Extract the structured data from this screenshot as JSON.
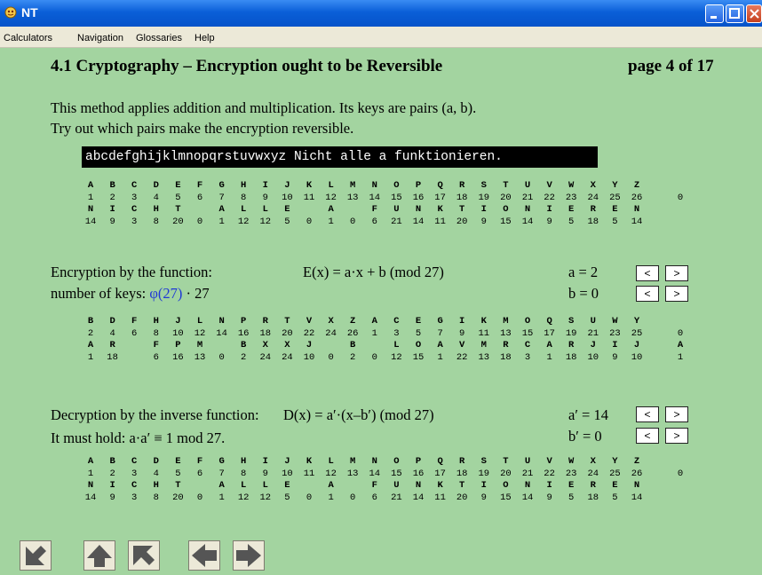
{
  "window": {
    "title": "NT"
  },
  "menu": [
    "Calculators",
    "Navigation",
    "Glossaries",
    "Help"
  ],
  "header": {
    "title": "4.1 Cryptography – Encryption ought to be Reversible",
    "page": "page 4 of 17"
  },
  "intro": {
    "line1": "This method applies addition and multiplication. Its keys are pairs (a, b).",
    "line2": "Try out which pairs make the encryption reversible."
  },
  "input": {
    "value": "abcdefghijklmnopqrstuvwxyz Nicht alle a funktionieren."
  },
  "table1": {
    "letters": [
      "A",
      "B",
      "C",
      "D",
      "E",
      "F",
      "G",
      "H",
      "I",
      "J",
      "K",
      "L",
      "M",
      "N",
      "O",
      "P",
      "Q",
      "R",
      "S",
      "T",
      "U",
      "V",
      "W",
      "X",
      "Y",
      "Z",
      ""
    ],
    "numbers": [
      "1",
      "2",
      "3",
      "4",
      "5",
      "6",
      "7",
      "8",
      "9",
      "10",
      "11",
      "12",
      "13",
      "14",
      "15",
      "16",
      "17",
      "18",
      "19",
      "20",
      "21",
      "22",
      "23",
      "24",
      "25",
      "26",
      "0"
    ],
    "letters2": [
      "N",
      "I",
      "C",
      "H",
      "T",
      "",
      "A",
      "L",
      "L",
      "E",
      "",
      "A",
      "",
      "F",
      "U",
      "N",
      "K",
      "T",
      "I",
      "O",
      "N",
      "I",
      "E",
      "R",
      "E",
      "N"
    ],
    "numbers2": [
      "14",
      "9",
      "3",
      "8",
      "20",
      "0",
      "1",
      "12",
      "12",
      "5",
      "0",
      "1",
      "0",
      "6",
      "21",
      "14",
      "11",
      "20",
      "9",
      "15",
      "14",
      "9",
      "5",
      "18",
      "5",
      "14"
    ]
  },
  "encryption": {
    "label": "Encryption by the function:",
    "formula": "E(x) = a·x + b (mod 27)",
    "keys_label": "number of keys:",
    "keys_phi": "φ(27)",
    "keys_rest": "· 27",
    "a_label": "a = 2",
    "b_label": "b = 0",
    "btn_dec": "<",
    "btn_inc": ">"
  },
  "table2": {
    "letters": [
      "B",
      "D",
      "F",
      "H",
      "J",
      "L",
      "N",
      "P",
      "R",
      "T",
      "V",
      "X",
      "Z",
      "A",
      "C",
      "E",
      "G",
      "I",
      "K",
      "M",
      "O",
      "Q",
      "S",
      "U",
      "W",
      "Y",
      ""
    ],
    "numbers": [
      "2",
      "4",
      "6",
      "8",
      "10",
      "12",
      "14",
      "16",
      "18",
      "20",
      "22",
      "24",
      "26",
      "1",
      "3",
      "5",
      "7",
      "9",
      "11",
      "13",
      "15",
      "17",
      "19",
      "21",
      "23",
      "25",
      "0"
    ],
    "letters2": [
      "A",
      "R",
      "",
      "F",
      "P",
      "M",
      "",
      "B",
      "X",
      "X",
      "J",
      "",
      "B",
      "",
      "L",
      "O",
      "A",
      "V",
      "M",
      "R",
      "C",
      "A",
      "R",
      "J",
      "I",
      "J",
      "A"
    ],
    "numbers2": [
      "1",
      "18",
      "",
      "6",
      "16",
      "13",
      "0",
      "2",
      "24",
      "24",
      "10",
      "0",
      "2",
      "0",
      "12",
      "15",
      "1",
      "22",
      "13",
      "18",
      "3",
      "1",
      "18",
      "10",
      "9",
      "10",
      "1"
    ]
  },
  "decryption": {
    "label": "Decryption by the inverse function:",
    "formula": "D(x) = a′·(x–b′) (mod 27)",
    "condition": "It must hold:  a·a′ ≡ 1 mod 27.",
    "a_label": "a′ = 14",
    "b_label": "b′ = 0",
    "btn_dec": "<",
    "btn_inc": ">"
  },
  "table3": {
    "letters": [
      "A",
      "B",
      "C",
      "D",
      "E",
      "F",
      "G",
      "H",
      "I",
      "J",
      "K",
      "L",
      "M",
      "N",
      "O",
      "P",
      "Q",
      "R",
      "S",
      "T",
      "U",
      "V",
      "W",
      "X",
      "Y",
      "Z",
      ""
    ],
    "numbers": [
      "1",
      "2",
      "3",
      "4",
      "5",
      "6",
      "7",
      "8",
      "9",
      "10",
      "11",
      "12",
      "13",
      "14",
      "15",
      "16",
      "17",
      "18",
      "19",
      "20",
      "21",
      "22",
      "23",
      "24",
      "25",
      "26",
      "0"
    ],
    "letters2": [
      "N",
      "I",
      "C",
      "H",
      "T",
      "",
      "A",
      "L",
      "L",
      "E",
      "",
      "A",
      "",
      "F",
      "U",
      "N",
      "K",
      "T",
      "I",
      "O",
      "N",
      "I",
      "E",
      "R",
      "E",
      "N"
    ],
    "numbers2": [
      "14",
      "9",
      "3",
      "8",
      "20",
      "0",
      "1",
      "12",
      "12",
      "5",
      "0",
      "1",
      "0",
      "6",
      "21",
      "14",
      "11",
      "20",
      "9",
      "15",
      "14",
      "9",
      "5",
      "18",
      "5",
      "14"
    ]
  },
  "nav_icons": [
    "back-to-start-icon",
    "up-icon",
    "up-left-icon",
    "previous-page-icon",
    "next-page-icon"
  ]
}
